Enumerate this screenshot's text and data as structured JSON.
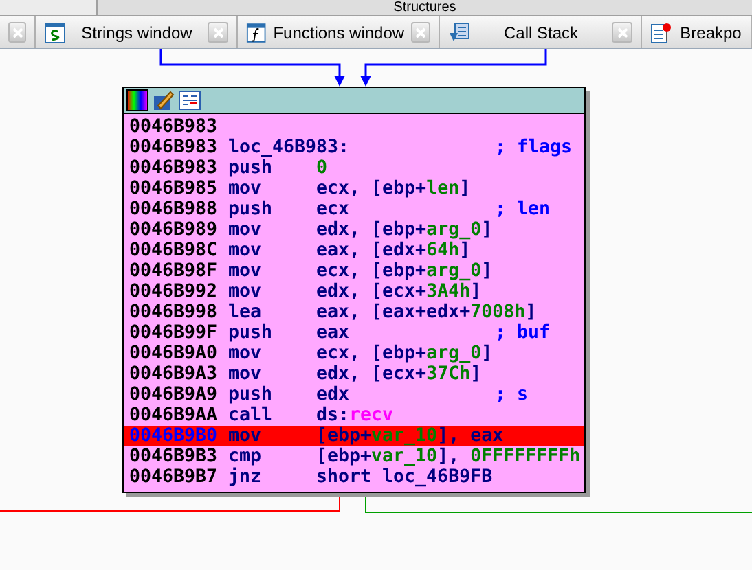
{
  "top_tabs": [
    {
      "label": "Structures",
      "selected": false
    }
  ],
  "tabs": [
    {
      "kind": "partial"
    },
    {
      "label": "Strings window",
      "kind": "strings"
    },
    {
      "label": "Functions window",
      "kind": "function"
    },
    {
      "label": "Call Stack",
      "kind": "stack"
    },
    {
      "label": "Breakpo",
      "kind": "breakpoint"
    }
  ],
  "node": {
    "lines": [
      {
        "kind": "address",
        "address": "0046B983",
        "selected": false
      },
      {
        "kind": "label",
        "address": "0046B983",
        "label": "loc_46B983:",
        "comment": "; flags",
        "selected": false
      },
      {
        "kind": "instr",
        "address": "0046B983",
        "mnemonic": "push",
        "operand": [
          {
            "text": "0",
            "kind": "name"
          }
        ],
        "selected": false
      },
      {
        "kind": "instr",
        "address": "0046B985",
        "mnemonic": "mov",
        "operand": [
          {
            "text": "ecx, [ebp+",
            "kind": "reg"
          },
          {
            "text": "len",
            "kind": "name"
          },
          {
            "text": "]",
            "kind": "reg"
          }
        ],
        "selected": false
      },
      {
        "kind": "instr",
        "address": "0046B988",
        "mnemonic": "push",
        "operand": [
          {
            "text": "ecx",
            "kind": "reg"
          }
        ],
        "comment": "; len",
        "selected": false
      },
      {
        "kind": "instr",
        "address": "0046B989",
        "mnemonic": "mov",
        "operand": [
          {
            "text": "edx, [ebp+",
            "kind": "reg"
          },
          {
            "text": "arg_0",
            "kind": "name"
          },
          {
            "text": "]",
            "kind": "reg"
          }
        ],
        "selected": false
      },
      {
        "kind": "instr",
        "address": "0046B98C",
        "mnemonic": "mov",
        "operand": [
          {
            "text": "eax, [edx+",
            "kind": "reg"
          },
          {
            "text": "64h",
            "kind": "name"
          },
          {
            "text": "]",
            "kind": "reg"
          }
        ],
        "selected": false
      },
      {
        "kind": "instr",
        "address": "0046B98F",
        "mnemonic": "mov",
        "operand": [
          {
            "text": "ecx, [ebp+",
            "kind": "reg"
          },
          {
            "text": "arg_0",
            "kind": "name"
          },
          {
            "text": "]",
            "kind": "reg"
          }
        ],
        "selected": false
      },
      {
        "kind": "instr",
        "address": "0046B992",
        "mnemonic": "mov",
        "operand": [
          {
            "text": "edx, [ecx+",
            "kind": "reg"
          },
          {
            "text": "3A4h",
            "kind": "name"
          },
          {
            "text": "]",
            "kind": "reg"
          }
        ],
        "selected": false
      },
      {
        "kind": "instr",
        "address": "0046B998",
        "mnemonic": "lea",
        "operand": [
          {
            "text": "eax, [eax+edx+",
            "kind": "reg"
          },
          {
            "text": "7008h",
            "kind": "name"
          },
          {
            "text": "]",
            "kind": "reg"
          }
        ],
        "selected": false
      },
      {
        "kind": "instr",
        "address": "0046B99F",
        "mnemonic": "push",
        "operand": [
          {
            "text": "eax",
            "kind": "reg"
          }
        ],
        "comment": "; buf",
        "selected": false
      },
      {
        "kind": "instr",
        "address": "0046B9A0",
        "mnemonic": "mov",
        "operand": [
          {
            "text": "ecx, [ebp+",
            "kind": "reg"
          },
          {
            "text": "arg_0",
            "kind": "name"
          },
          {
            "text": "]",
            "kind": "reg"
          }
        ],
        "selected": false
      },
      {
        "kind": "instr",
        "address": "0046B9A3",
        "mnemonic": "mov",
        "operand": [
          {
            "text": "edx, [ecx+",
            "kind": "reg"
          },
          {
            "text": "37Ch",
            "kind": "name"
          },
          {
            "text": "]",
            "kind": "reg"
          }
        ],
        "selected": false
      },
      {
        "kind": "instr",
        "address": "0046B9A9",
        "mnemonic": "push",
        "operand": [
          {
            "text": "edx",
            "kind": "reg"
          }
        ],
        "comment": "; s",
        "selected": false
      },
      {
        "kind": "instr",
        "address": "0046B9AA",
        "mnemonic": "call",
        "operand": [
          {
            "text": "ds:",
            "kind": "reg"
          },
          {
            "text": "recv",
            "kind": "import"
          }
        ],
        "selected": false
      },
      {
        "kind": "instr",
        "address": "0046B9B0",
        "mnemonic": "mov",
        "operand": [
          {
            "text": "[ebp+",
            "kind": "reg"
          },
          {
            "text": "var_10",
            "kind": "name"
          },
          {
            "text": "], eax",
            "kind": "reg"
          }
        ],
        "selected": true
      },
      {
        "kind": "instr",
        "address": "0046B9B3",
        "mnemonic": "cmp",
        "operand": [
          {
            "text": "[ebp+",
            "kind": "reg"
          },
          {
            "text": "var_10",
            "kind": "name"
          },
          {
            "text": "], ",
            "kind": "reg"
          },
          {
            "text": "0FFFFFFFFh",
            "kind": "name"
          }
        ],
        "selected": false
      },
      {
        "kind": "instr",
        "address": "0046B9B7",
        "mnemonic": "jnz",
        "operand": [
          {
            "text": "short loc_46B9FB",
            "kind": "reg"
          }
        ],
        "selected": false
      }
    ]
  }
}
